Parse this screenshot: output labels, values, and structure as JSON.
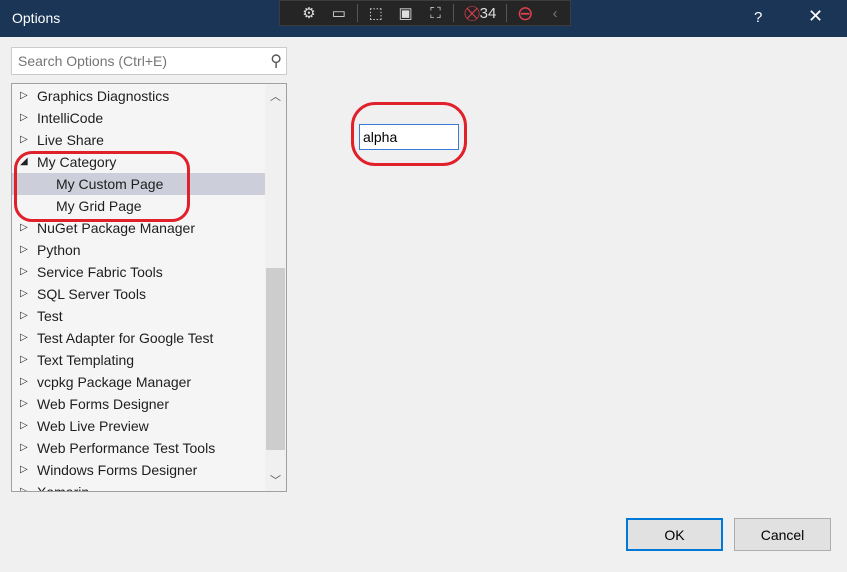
{
  "window": {
    "title": "Options",
    "help_label": "?",
    "close_label": "✕"
  },
  "debug_toolbar": {
    "items": [
      {
        "icon": "visual-tree-icon",
        "glyph": "⚙"
      },
      {
        "icon": "video-camera-icon",
        "glyph": "▭"
      },
      {
        "icon": "select-element-icon",
        "glyph": "⬚"
      },
      {
        "icon": "display-layout-adorners-icon",
        "glyph": "▣"
      },
      {
        "icon": "track-focus-icon",
        "glyph": "⛶"
      }
    ],
    "binding_errors_count": "34",
    "binding_error_icon": "⛒",
    "stop-icon": "⊖",
    "collapse_glyph": "‹"
  },
  "search": {
    "placeholder": "Search Options (Ctrl+E)",
    "value": ""
  },
  "tree": {
    "items": [
      {
        "label": "Graphics Diagnostics",
        "expanded": false,
        "level": 0
      },
      {
        "label": "IntelliCode",
        "expanded": false,
        "level": 0
      },
      {
        "label": "Live Share",
        "expanded": false,
        "level": 0
      },
      {
        "label": "My Category",
        "expanded": true,
        "level": 0
      },
      {
        "label": "My Custom Page",
        "level": 1,
        "selected": true
      },
      {
        "label": "My Grid Page",
        "level": 1
      },
      {
        "label": "NuGet Package Manager",
        "expanded": false,
        "level": 0
      },
      {
        "label": "Python",
        "expanded": false,
        "level": 0
      },
      {
        "label": "Service Fabric Tools",
        "expanded": false,
        "level": 0
      },
      {
        "label": "SQL Server Tools",
        "expanded": false,
        "level": 0
      },
      {
        "label": "Test",
        "expanded": false,
        "level": 0
      },
      {
        "label": "Test Adapter for Google Test",
        "expanded": false,
        "level": 0
      },
      {
        "label": "Text Templating",
        "expanded": false,
        "level": 0
      },
      {
        "label": "vcpkg Package Manager",
        "expanded": false,
        "level": 0
      },
      {
        "label": "Web Forms Designer",
        "expanded": false,
        "level": 0
      },
      {
        "label": "Web Live Preview",
        "expanded": false,
        "level": 0
      },
      {
        "label": "Web Performance Test Tools",
        "expanded": false,
        "level": 0
      },
      {
        "label": "Windows Forms Designer",
        "expanded": false,
        "level": 0
      },
      {
        "label": "Xamarin",
        "expanded": false,
        "level": 0
      }
    ]
  },
  "page": {
    "text_value": "alpha"
  },
  "buttons": {
    "ok": "OK",
    "cancel": "Cancel"
  },
  "colors": {
    "titlebar": "#1b3556",
    "selection": "#ccced9",
    "annotation": "#e0202a",
    "focus": "#0078d7"
  }
}
